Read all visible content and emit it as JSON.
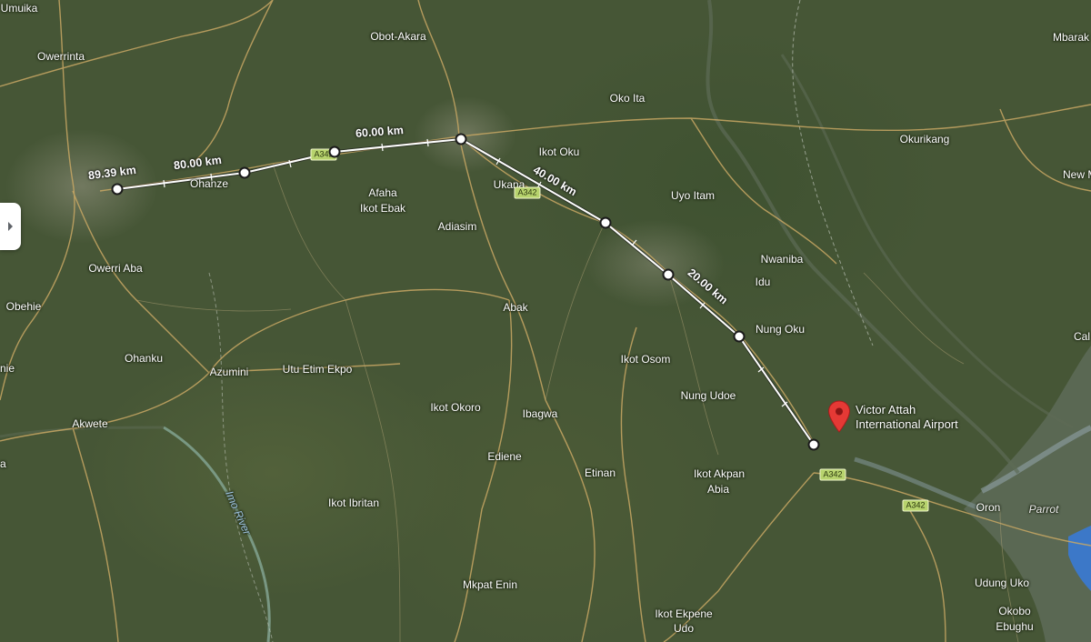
{
  "map": {
    "type": "satellite",
    "sidebar_toggle": "chevron-right-icon",
    "marker": {
      "icon": "red-map-pin-icon",
      "name_line1": "Victor Attah",
      "name_line2": "International Airport",
      "color": "#e53935"
    },
    "measurement": {
      "color": "#ffffff",
      "distances": [
        {
          "text": "89.39 km"
        },
        {
          "text": "80.00 km"
        },
        {
          "text": "60.00 km"
        },
        {
          "text": "40.00 km"
        },
        {
          "text": "20.00 km"
        }
      ]
    },
    "road_shields": [
      "A342",
      "A342",
      "A342",
      "A342",
      "A342"
    ],
    "river_label": "Imo River",
    "sea_label": "Parrot",
    "places": [
      "Umuika",
      "Owerrinta",
      "Obot-Akara",
      "Mbarak",
      "Oko Ita",
      "Ikot Oku",
      "Okurikang",
      "New M",
      "Ohanze",
      "Ukana",
      "Afaha",
      "Ikot Ebak",
      "Uyo Itam",
      "Adiasim",
      "Owerri Aba",
      "Nwaniba",
      "Idu",
      "Obehie",
      "Abak",
      "Nung Oku",
      "Cal",
      "Ohanku",
      "Azumini",
      "Utu Etim Ekpo",
      "Ikot Osom",
      "nie",
      "Nung Udoe",
      "Ikot Okoro",
      "Akwete",
      "Ibagwa",
      "Ediene",
      "Etinan",
      "Ikot Akpan",
      "Abia",
      "a",
      "Oron",
      "Ikot Ibritan",
      "Mkpat Enin",
      "Udung Uko",
      "Ikot Ekpene",
      "Udo",
      "Okobo",
      "Ebughu"
    ]
  }
}
